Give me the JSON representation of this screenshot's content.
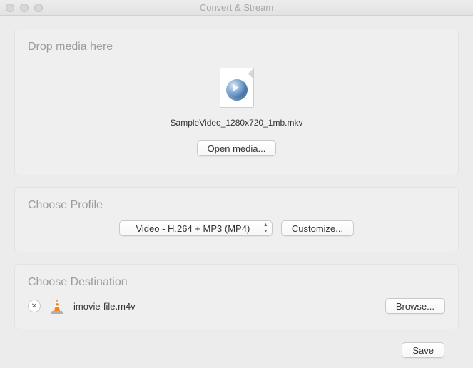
{
  "window": {
    "title": "Convert & Stream"
  },
  "drop": {
    "heading": "Drop media here",
    "filename": "SampleVideo_1280x720_1mb.mkv",
    "open_button": "Open media..."
  },
  "profile": {
    "heading": "Choose Profile",
    "selected": "Video - H.264 + MP3 (MP4)",
    "customize_button": "Customize..."
  },
  "destination": {
    "heading": "Choose Destination",
    "filename": "imovie-file.m4v",
    "browse_button": "Browse..."
  },
  "footer": {
    "save_button": "Save"
  }
}
